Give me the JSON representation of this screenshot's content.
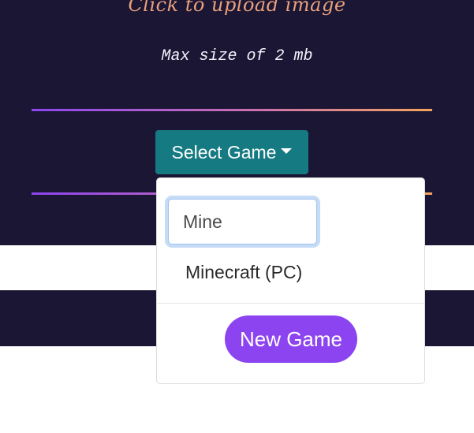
{
  "upload": {
    "prompt": "Click to upload image",
    "max_size": "Max size of 2 mb"
  },
  "select_game": {
    "label": "Select Game"
  },
  "dropdown": {
    "search_value": "Mine",
    "results": [
      "Minecraft (PC)"
    ],
    "new_game_label": "New Game"
  },
  "colors": {
    "background_dark": "#1b1634",
    "select_button": "#157a82",
    "new_game_button": "#8c44f0",
    "upload_text": "#e8a07c",
    "gradient_start": "#8b45f0",
    "gradient_end": "#f4a35c"
  },
  "icons": {
    "select_caret": "caret-down-icon"
  }
}
